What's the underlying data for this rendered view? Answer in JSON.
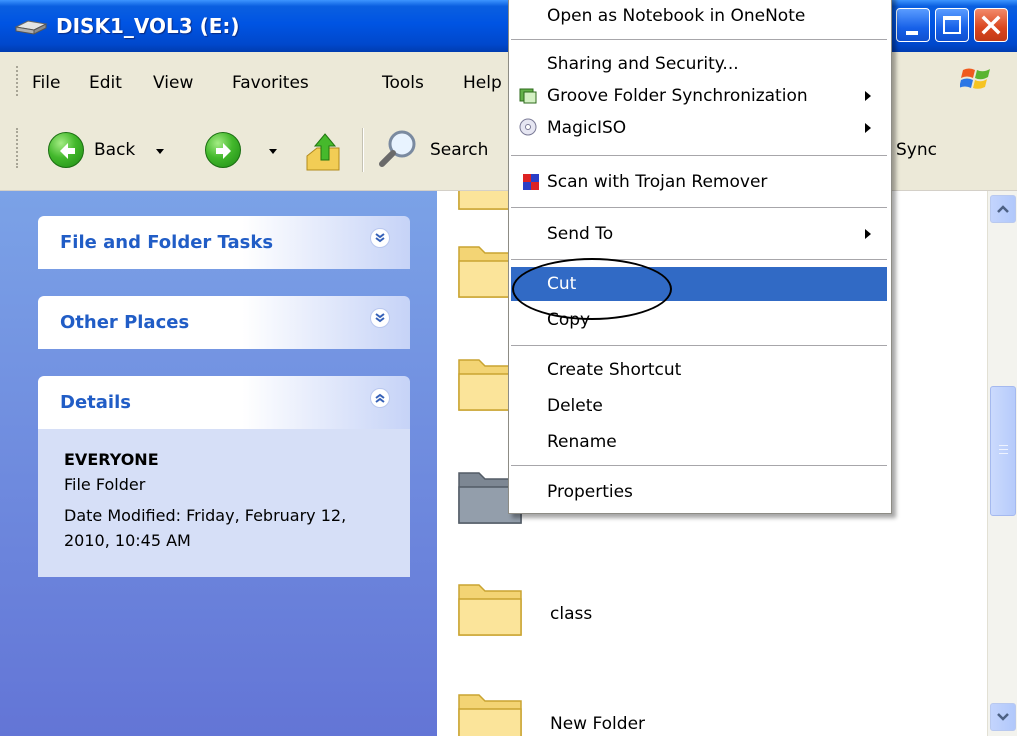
{
  "window": {
    "title": "DISK1_VOL3 (E:)",
    "icon": "drive-icon"
  },
  "menubar": {
    "items": [
      "File",
      "Edit",
      "View",
      "Favorites",
      "Tools",
      "Help"
    ]
  },
  "toolbar": {
    "back_label": "Back",
    "search_label": "Search",
    "sync_label": "Sync"
  },
  "taskpane": {
    "file_folder_tasks": "File and Folder Tasks",
    "other_places": "Other Places",
    "details": "Details",
    "details_name": "EVERYONE",
    "details_type": "File Folder",
    "details_modified": "Date Modified: Friday, February 12, 2010, 10:45 AM"
  },
  "files": {
    "folder_class": "class",
    "folder_new": "New Folder"
  },
  "context_menu": {
    "open_onenote": "Open as Notebook in OneNote",
    "sharing": "Sharing and Security...",
    "groove": "Groove Folder Synchronization",
    "magiciso": "MagicISO",
    "trojan": "Scan with Trojan Remover",
    "send_to": "Send To",
    "cut": "Cut",
    "copy": "Copy",
    "create_shortcut": "Create Shortcut",
    "delete": "Delete",
    "rename": "Rename",
    "properties": "Properties",
    "highlight_color": "#316ac5"
  },
  "colors": {
    "titlebar": "#0054e3",
    "taskpane": "#6f8fe0",
    "task_header_text": "#215dc6"
  }
}
